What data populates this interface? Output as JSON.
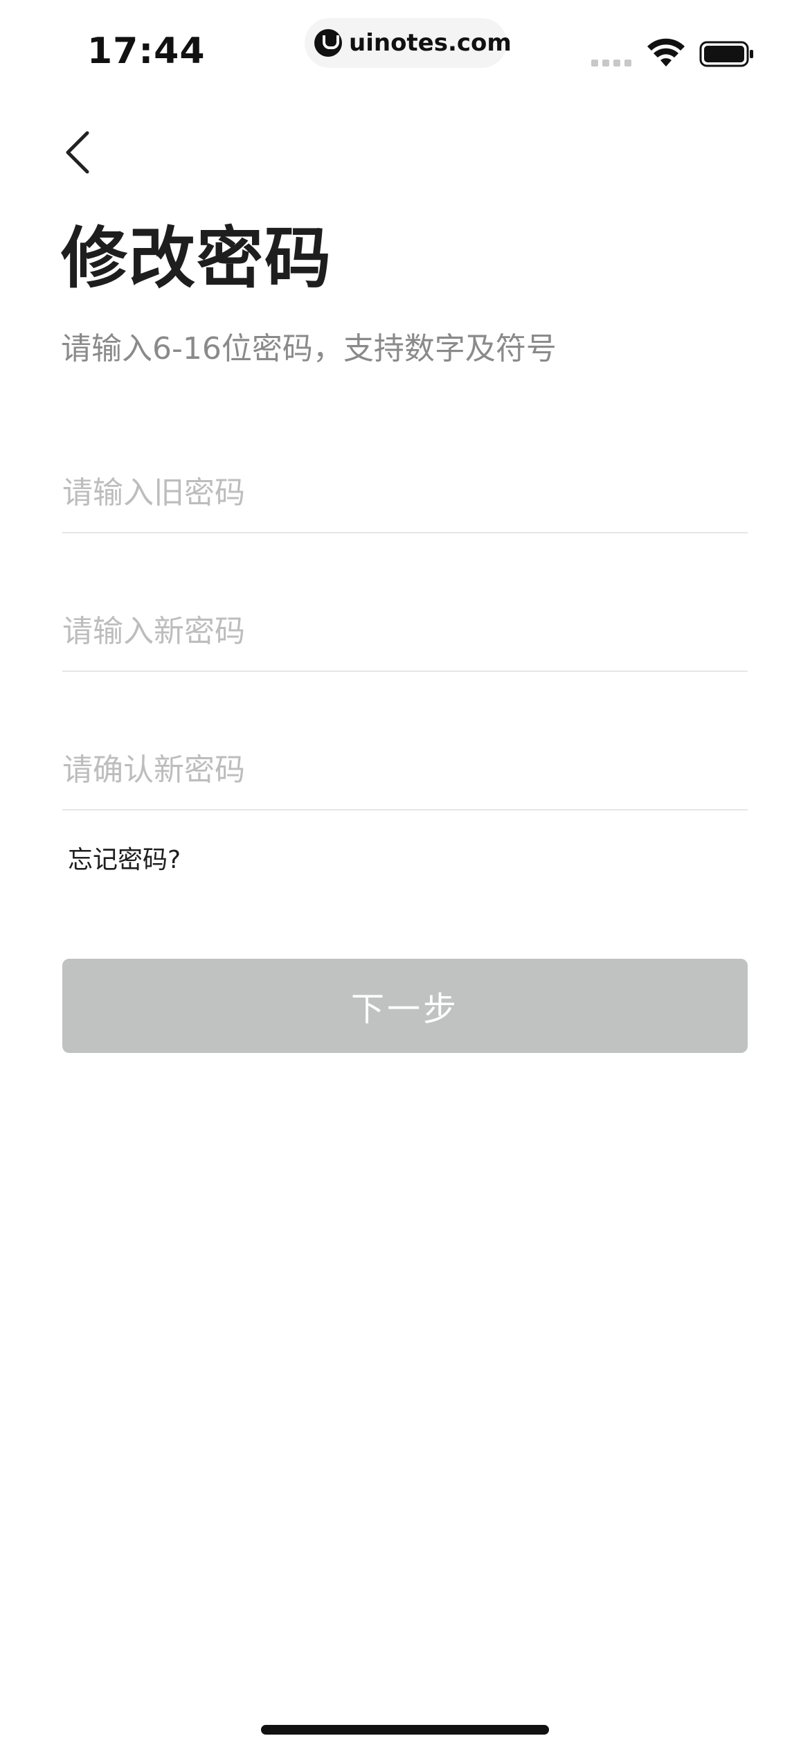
{
  "status_bar": {
    "time": "17:44",
    "url": "uinotes.com",
    "icons": [
      "signal-dots-icon",
      "wifi-icon",
      "battery-icon"
    ]
  },
  "nav": {
    "back_icon": "chevron-left-icon"
  },
  "header": {
    "title": "修改密码",
    "subtitle": "请输入6-16位密码，支持数字及符号"
  },
  "form": {
    "old_password": {
      "placeholder": "请输入旧密码",
      "value": ""
    },
    "new_password": {
      "placeholder": "请输入新密码",
      "value": ""
    },
    "confirm_password": {
      "placeholder": "请确认新密码",
      "value": ""
    },
    "forgot_label": "忘记密码?",
    "next_label": "下一步"
  },
  "colors": {
    "title": "#1e1e1e",
    "subtitle": "#8a8a8a",
    "placeholder": "#bdbdbd",
    "divider": "#e6e6e6",
    "button_disabled_bg": "#c0c2c2",
    "button_text": "#ffffff"
  }
}
